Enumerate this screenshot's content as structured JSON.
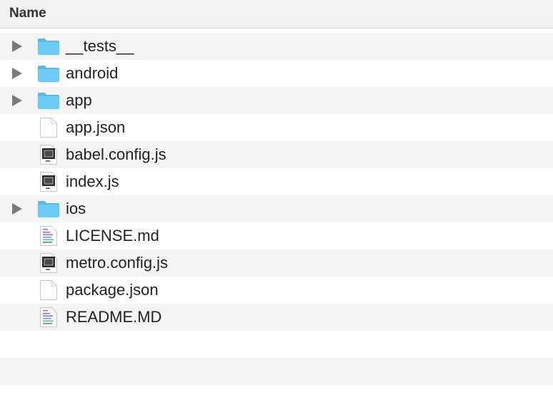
{
  "header": {
    "name_label": "Name"
  },
  "files": [
    {
      "name": "__tests__",
      "kind": "folder",
      "icon": "folder-icon",
      "expandable": true
    },
    {
      "name": "android",
      "kind": "folder",
      "icon": "folder-icon",
      "expandable": true
    },
    {
      "name": "app",
      "kind": "folder",
      "icon": "folder-icon",
      "expandable": true
    },
    {
      "name": "app.json",
      "kind": "file",
      "icon": "blank-document-icon",
      "expandable": false
    },
    {
      "name": "babel.config.js",
      "kind": "script",
      "icon": "javascript-file-icon",
      "expandable": false
    },
    {
      "name": "index.js",
      "kind": "script",
      "icon": "javascript-file-icon",
      "expandable": false
    },
    {
      "name": "ios",
      "kind": "folder",
      "icon": "folder-icon",
      "expandable": true
    },
    {
      "name": "LICENSE.md",
      "kind": "text",
      "icon": "text-document-icon",
      "expandable": false
    },
    {
      "name": "metro.config.js",
      "kind": "script",
      "icon": "javascript-file-icon",
      "expandable": false
    },
    {
      "name": "package.json",
      "kind": "file",
      "icon": "blank-document-icon",
      "expandable": false
    },
    {
      "name": "README.MD",
      "kind": "text",
      "icon": "text-document-icon",
      "expandable": false
    }
  ],
  "colors": {
    "folder": "#6ccbf5",
    "folder_tab": "#56b9e6",
    "row_alt": "#f4f4f4",
    "header_bg": "#f1f1f1"
  }
}
